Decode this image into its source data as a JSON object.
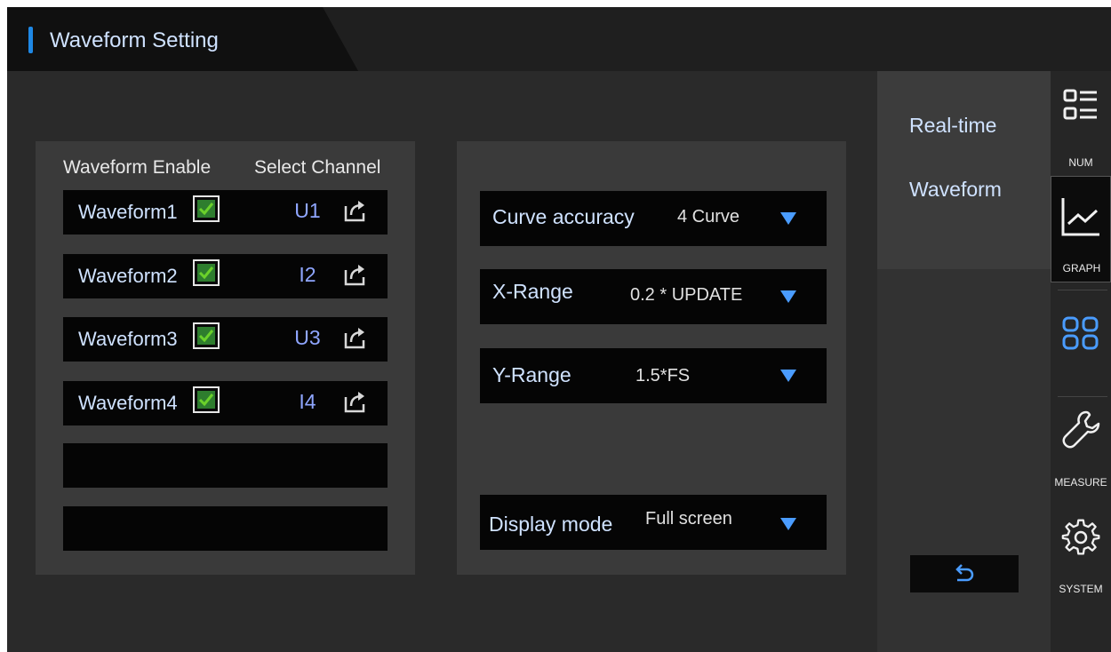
{
  "header": {
    "title": "Waveform Setting"
  },
  "waveform_panel": {
    "enable_header": "Waveform Enable",
    "channel_header": "Select Channel",
    "rows": [
      {
        "label": "Waveform1",
        "checked": true,
        "channel": "U1"
      },
      {
        "label": "Waveform2",
        "checked": true,
        "channel": "I2"
      },
      {
        "label": "Waveform3",
        "checked": true,
        "channel": "U3"
      },
      {
        "label": "Waveform4",
        "checked": true,
        "channel": "I4"
      }
    ]
  },
  "settings": {
    "curve_accuracy": {
      "label": "Curve accuracy",
      "value": "4 Curve"
    },
    "x_range": {
      "label": "X-Range",
      "value": "0.2 * UPDATE"
    },
    "y_range": {
      "label": "Y-Range",
      "value": "1.5*FS"
    },
    "display_mode": {
      "label": "Display mode",
      "value": "Full screen"
    }
  },
  "submenu": {
    "item1": "Real-time",
    "item2": "Waveform"
  },
  "nav": {
    "num": "NUM",
    "graph": "GRAPH",
    "measure": "MEASURE",
    "system": "SYSTEM"
  },
  "icons": {
    "checkbox": "checkmark-icon",
    "channel_select": "share-icon",
    "dropdown": "triangle-down-icon",
    "back": "undo-arrow-icon",
    "num": "list-icon",
    "graph": "line-chart-icon",
    "grid": "grid-icon",
    "measure": "wrench-icon",
    "system": "gear-icon"
  },
  "colors": {
    "accent": "#1e88e5",
    "check": "#6bd12a",
    "label_blue": "#cfe2ff",
    "channel": "#8fa6ff",
    "arrow": "#4a9cff"
  }
}
